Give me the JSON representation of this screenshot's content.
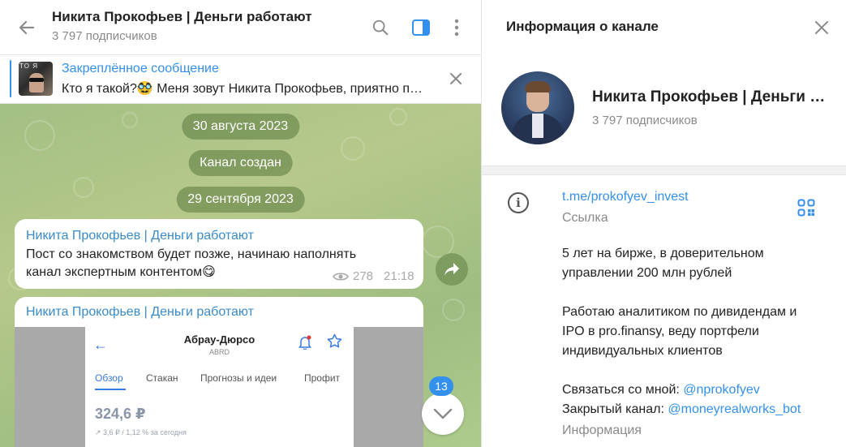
{
  "chat": {
    "title": "Никита Прокофьев | Деньги работают",
    "subscribers": "3 797 подписчиков",
    "icons": [
      "back-arrow-icon",
      "search-icon",
      "sidebar-toggle-icon",
      "more-vertical-icon"
    ],
    "pinned": {
      "title": "Закреплённое сообщение",
      "text": "Кто я такой?🥸  Меня зовут Никита Прокофьев, приятно познакомиться",
      "thumb_text": "TO Я"
    },
    "date_1": "30 августа 2023",
    "service": "Канал создан",
    "date_2": "29 сентября 2023",
    "message_1": {
      "author": "Никита Прокофьев | Деньги работают",
      "line_1": "Пост со знакомством будет позже, начинаю наполнять",
      "line_2": "канал экспертным контентом😋",
      "views": "278",
      "time": "21:18"
    },
    "message_2": {
      "author": "Никита Прокофьев | Деньги работают",
      "screenshot": {
        "back": "←",
        "title": "Абрау-Дюрсо",
        "ticker": "ABRD",
        "tabs": [
          "Обзор",
          "Стакан",
          "Прогнозы и идеи",
          "Профит"
        ],
        "price": "324,6 ₽",
        "change": "↗ 3,6 ₽ / 1,12 % за сегодня"
      }
    },
    "unread_count": "13"
  },
  "info": {
    "title": "Информация о канале",
    "channel_name": "Никита Прокофьев | Деньги работают",
    "subscribers": "3 797 подписчиков",
    "link": "t.me/prokofyev_invest",
    "link_label": "Ссылка",
    "desc_1_a": "5 лет на бирже, в доверительном",
    "desc_1_b": "управлении 200 млн рублей",
    "desc_2_a": "Работаю аналитиком по дивидендам и",
    "desc_2_b": "IPO в pro.finansy, веду портфели",
    "desc_2_c": "индивидуальных клиентов",
    "contact_label": "Связаться со мной: ",
    "contact_handle": "@nprokofyev",
    "closed_label": "Закрытый канал: ",
    "closed_handle": "@moneyrealworks_bot",
    "desc_label": "Информация"
  },
  "colors": {
    "accent": "#3390ec",
    "author": "#3a8bc8",
    "wallpaper": "#a3bf84"
  }
}
